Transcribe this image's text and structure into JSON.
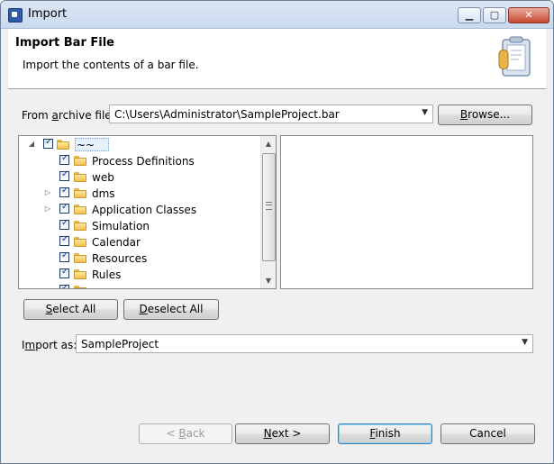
{
  "window": {
    "title": "Import"
  },
  "header": {
    "title": "Import Bar File",
    "description": "Import the contents of a bar file."
  },
  "archive": {
    "label_before": "From ",
    "label_mnemonic": "a",
    "label_after": "rchive file:",
    "value": "C:\\Users\\Administrator\\SampleProject.bar",
    "browse_mnemonic": "B",
    "browse_rest": "rowse..."
  },
  "tree": {
    "root": {
      "label": "~~",
      "checked": true
    },
    "items": [
      {
        "label": "Process Definitions",
        "checked": true,
        "expandable": false
      },
      {
        "label": "web",
        "checked": true,
        "expandable": false
      },
      {
        "label": "dms",
        "checked": true,
        "expandable": true
      },
      {
        "label": "Application Classes",
        "checked": true,
        "expandable": true
      },
      {
        "label": "Simulation",
        "checked": true,
        "expandable": false
      },
      {
        "label": "Calendar",
        "checked": true,
        "expandable": false
      },
      {
        "label": "Resources",
        "checked": true,
        "expandable": false
      },
      {
        "label": "Rules",
        "checked": true,
        "expandable": false
      }
    ]
  },
  "buttons": {
    "select_all_mnemonic": "S",
    "select_all_rest": "elect All",
    "deselect_all_mnemonic": "D",
    "deselect_all_rest": "eselect All",
    "back_prefix": "< ",
    "back_mnemonic": "B",
    "back_rest": "ack",
    "next_mnemonic": "N",
    "next_rest": "ext >",
    "finish_mnemonic": "F",
    "finish_rest": "inish",
    "cancel_label": "Cancel"
  },
  "import_as": {
    "label_before": "I",
    "label_mnemonic": "m",
    "label_after": "port as:",
    "value": "SampleProject"
  },
  "icons": {
    "window": "import-app-icon",
    "header": "archive-clipboard-icon",
    "folder": "folder-icon",
    "checkbox": "checkbox-checked-icon"
  }
}
